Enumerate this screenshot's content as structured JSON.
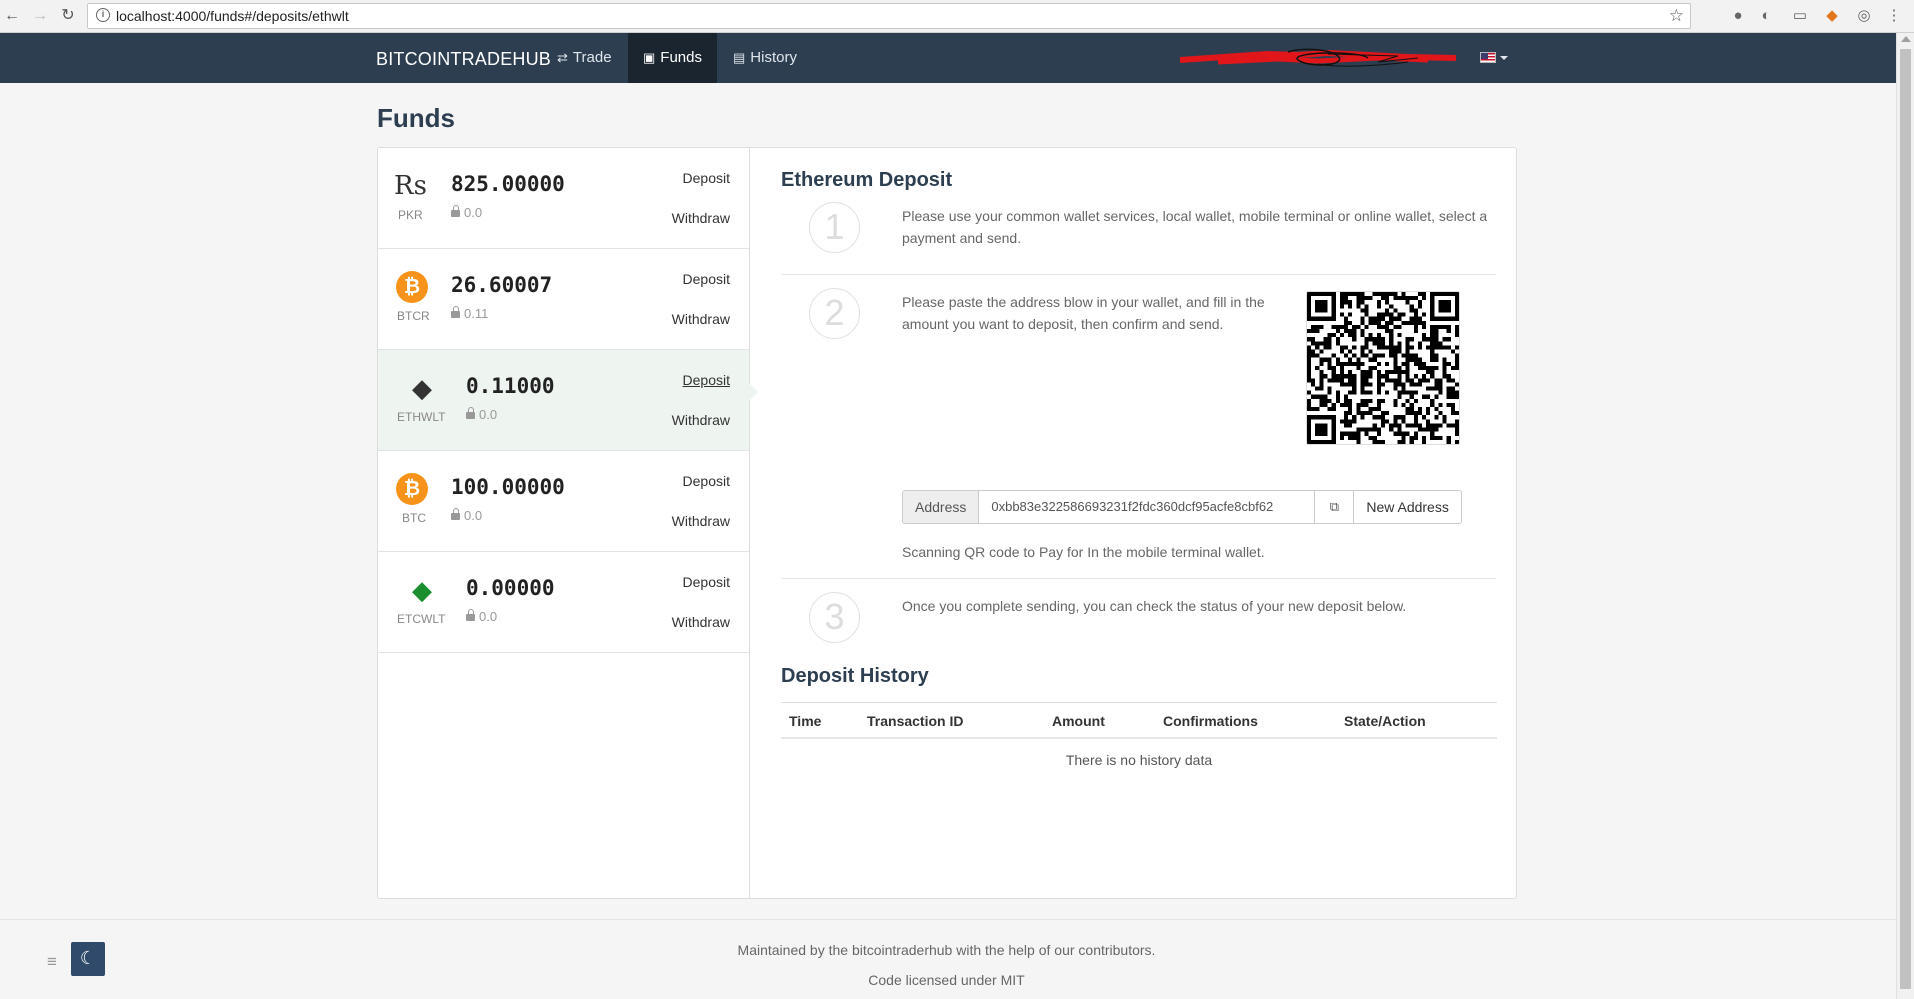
{
  "browser": {
    "url": "localhost:4000/funds#/deposits/ethwlt",
    "back_icon": "←",
    "forward_icon": "→",
    "reload_icon": "↻",
    "star_icon": "☆"
  },
  "navbar": {
    "brand": "BITCOINTRADEHUB",
    "items": [
      {
        "label": "Trade",
        "icon": "⇄"
      },
      {
        "label": "Funds",
        "icon": "▣"
      },
      {
        "label": "History",
        "icon": "▤"
      }
    ]
  },
  "page_title": "Funds",
  "funds": [
    {
      "code": "PKR",
      "amount": "825.00000",
      "locked": "0.0",
      "deposit": "Deposit",
      "withdraw": "Withdraw",
      "icon": "Rs"
    },
    {
      "code": "BTCR",
      "amount": "26.60007",
      "locked": "0.11",
      "deposit": "Deposit",
      "withdraw": "Withdraw",
      "icon": "₿"
    },
    {
      "code": "ETHWLT",
      "amount": "0.11000",
      "locked": "0.0",
      "deposit": "Deposit",
      "withdraw": "Withdraw",
      "icon": "◆"
    },
    {
      "code": "BTC",
      "amount": "100.00000",
      "locked": "0.0",
      "deposit": "Deposit",
      "withdraw": "Withdraw",
      "icon": "₿"
    },
    {
      "code": "ETCWLT",
      "amount": "0.00000",
      "locked": "0.0",
      "deposit": "Deposit",
      "withdraw": "Withdraw",
      "icon": "◆"
    }
  ],
  "deposit": {
    "title": "Ethereum Deposit",
    "steps": [
      {
        "number": "1",
        "text": "Please use your common wallet services, local wallet, mobile terminal or online wallet, select a payment and send."
      },
      {
        "number": "2",
        "text": "Please paste the address blow in your wallet, and fill in the amount you want to deposit, then confirm and send."
      },
      {
        "number": "3",
        "text": "Once you complete sending, you can check the status of your new deposit below."
      }
    ],
    "address_label": "Address",
    "address_value": "0xbb83e322586693231f2fdc360dcf95acfe8cbf62",
    "copy_icon": "⧉",
    "new_address_label": "New Address",
    "qr_hint": "Scanning QR code to Pay for In the mobile terminal wallet."
  },
  "history": {
    "title": "Deposit History",
    "columns": [
      "Time",
      "Transaction ID",
      "Amount",
      "Confirmations",
      "State/Action"
    ],
    "empty_text": "There is no history data"
  },
  "footer": {
    "line1": "Maintained by the bitcointraderhub with the help of our contributors.",
    "line2": "Code licensed under MIT",
    "menu_icon": "≡",
    "moon_icon": "☾"
  },
  "colors": {
    "navbar_bg": "#2c3e50",
    "nav_active_bg": "#1a252f",
    "btc_orange": "#f7931a",
    "etc_green": "#1b8e2e",
    "active_row_bg": "#eef4f0"
  }
}
